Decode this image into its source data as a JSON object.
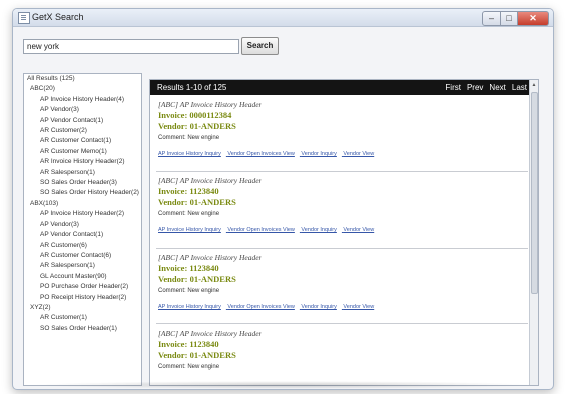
{
  "window": {
    "title": "GetX Search",
    "buttons": {
      "minimize": "–",
      "maximize": "□",
      "close": "✕"
    }
  },
  "search": {
    "query": "new york",
    "button_label": "Search"
  },
  "sidebar": {
    "items": [
      {
        "label": "All Results (125)",
        "level": 0
      },
      {
        "label": "ABC(20)",
        "level": 1
      },
      {
        "label": "AP Invoice History Header(4)",
        "level": 2
      },
      {
        "label": "AP Vendor(3)",
        "level": 2
      },
      {
        "label": "AP Vendor Contact(1)",
        "level": 2
      },
      {
        "label": "AR Customer(2)",
        "level": 2
      },
      {
        "label": "AR Customer Contact(1)",
        "level": 2
      },
      {
        "label": "AR Customer Memo(1)",
        "level": 2
      },
      {
        "label": "AR Invoice History Header(2)",
        "level": 2
      },
      {
        "label": "AR Salesperson(1)",
        "level": 2
      },
      {
        "label": "SO Sales Order Header(3)",
        "level": 2
      },
      {
        "label": "SO Sales Order History Header(2)",
        "level": 2
      },
      {
        "label": "ABX(103)",
        "level": 1
      },
      {
        "label": "AP Invoice History Header(2)",
        "level": 2
      },
      {
        "label": "AP Vendor(3)",
        "level": 2
      },
      {
        "label": "AP Vendor Contact(1)",
        "level": 2
      },
      {
        "label": "AR Customer(6)",
        "level": 2
      },
      {
        "label": "AR Customer Contact(6)",
        "level": 2
      },
      {
        "label": "AR Salesperson(1)",
        "level": 2
      },
      {
        "label": "GL Account Master(90)",
        "level": 2
      },
      {
        "label": "PO Purchase Order Header(2)",
        "level": 2
      },
      {
        "label": "PO Receipt History Header(2)",
        "level": 2
      },
      {
        "label": "XYZ(2)",
        "level": 1
      },
      {
        "label": "AR Customer(1)",
        "level": 2
      },
      {
        "label": "SO Sales Order Header(1)",
        "level": 2
      }
    ]
  },
  "results": {
    "title": "Results 1-10 of 125",
    "pager": [
      "First",
      "Prev",
      "Next",
      "Last"
    ],
    "items": [
      {
        "header": "[ABC] AP Invoice History Header",
        "invoice": "Invoice: 0000112384",
        "vendor": "Vendor: 01-ANDERS",
        "comment": "Comment: New engine",
        "links": [
          "AP Invoice History Inquiry",
          "Vendor Open Invoices View",
          "Vendor Inquiry",
          "Vendor View"
        ]
      },
      {
        "header": "[ABC] AP Invoice History Header",
        "invoice": "Invoice: 1123840",
        "vendor": "Vendor: 01-ANDERS",
        "comment": "Comment: New engine",
        "links": [
          "AP Invoice History Inquiry",
          "Vendor Open Invoices View",
          "Vendor Inquiry",
          "Vendor View"
        ]
      },
      {
        "header": "[ABC] AP Invoice History Header",
        "invoice": "Invoice: 1123840",
        "vendor": "Vendor: 01-ANDERS",
        "comment": "Comment: New engine",
        "links": [
          "AP Invoice History Inquiry",
          "Vendor Open Invoices View",
          "Vendor Inquiry",
          "Vendor View"
        ]
      },
      {
        "header": "[ABC] AP Invoice History Header",
        "invoice": "Invoice: 1123840",
        "vendor": "Vendor: 01-ANDERS",
        "comment": "Comment: New engine"
      }
    ]
  }
}
